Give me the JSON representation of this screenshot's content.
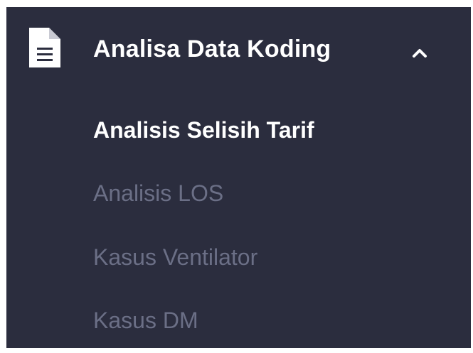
{
  "menu": {
    "header": {
      "icon": "document-icon",
      "label": "Analisa Data Koding",
      "chevron": "chevron-up-icon",
      "expanded": true
    },
    "items": [
      {
        "label": "Analisis Selisih Tarif",
        "active": true
      },
      {
        "label": "Analisis LOS",
        "active": false
      },
      {
        "label": "Kasus Ventilator",
        "active": false
      },
      {
        "label": "Kasus DM",
        "active": false
      }
    ]
  },
  "colors": {
    "background": "#2b2d3e",
    "active_text": "#ffffff",
    "inactive_text": "#6b6f86"
  }
}
